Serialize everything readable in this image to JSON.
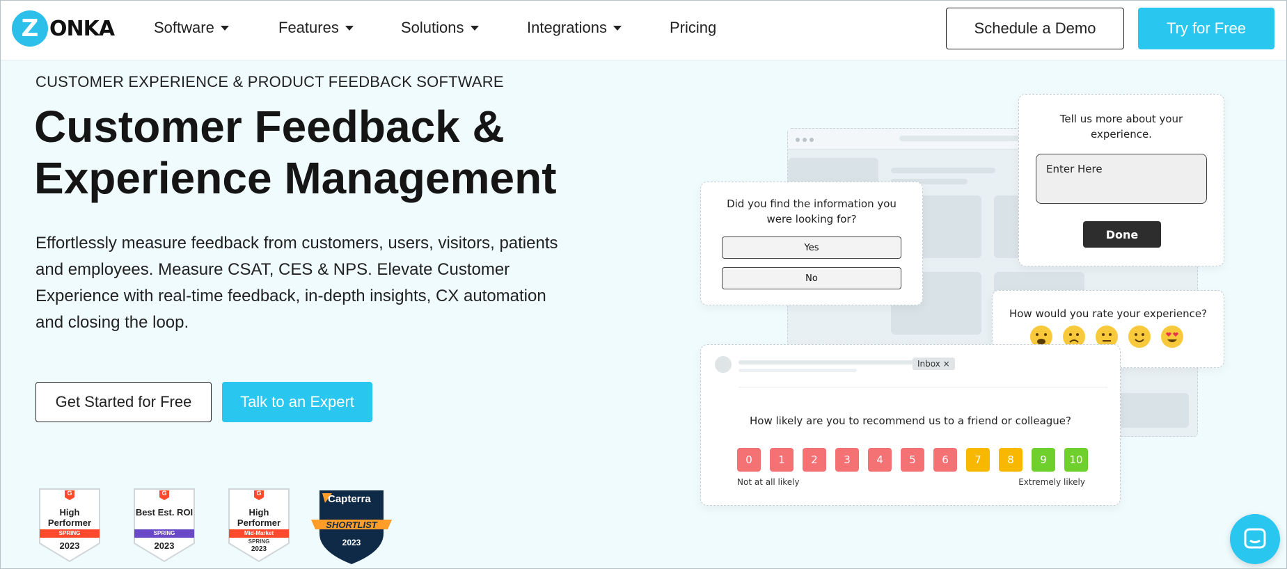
{
  "brand": {
    "logo_letter": "Z",
    "logo_text": "ONKA",
    "accent": "#29c6f0"
  },
  "nav": {
    "items": [
      {
        "label": "Software",
        "dropdown": true
      },
      {
        "label": "Features",
        "dropdown": true
      },
      {
        "label": "Solutions",
        "dropdown": true
      },
      {
        "label": "Integrations",
        "dropdown": true
      },
      {
        "label": "Pricing",
        "dropdown": false
      }
    ],
    "demo_label": "Schedule a Demo",
    "try_label": "Try for Free"
  },
  "hero": {
    "eyebrow": "CUSTOMER EXPERIENCE & PRODUCT FEEDBACK SOFTWARE",
    "title_line1": "Customer Feedback &",
    "title_line2": "Experience Management",
    "description": "Effortlessly measure feedback from customers, users, visitors, patients and employees. Measure CSAT, CES & NPS. Elevate Customer Experience with real-time feedback, in-depth insights, CX automation and closing the loop.",
    "primary_cta": "Get Started for Free",
    "secondary_cta": "Talk to an Expert"
  },
  "badges": [
    {
      "g2": "G",
      "title": "High Performer",
      "band": "SPRING",
      "year": "2023",
      "band_color": "#ff492c"
    },
    {
      "g2": "G",
      "title": "Best Est. ROI",
      "band": "SPRING",
      "year": "2023",
      "band_color": "#6a49c8"
    },
    {
      "g2": "G",
      "title": "High Performer",
      "band": "Mid-Market",
      "season": "SPRING",
      "year": "2023",
      "band_color": "#ff492c"
    }
  ],
  "capterra": {
    "name": "Capterra",
    "ribbon": "SHORTLIST",
    "year": "2023"
  },
  "illustration": {
    "info_card": {
      "question": "Did you find the information you were looking for?",
      "options": [
        "Yes",
        "No"
      ]
    },
    "more_card": {
      "question": "Tell us more about your experience.",
      "placeholder": "Enter Here",
      "done_label": "Done"
    },
    "rate_card": {
      "question": "How would you rate your experience?",
      "emojis": [
        "weary-face",
        "frowning-face",
        "neutral-face",
        "slightly-smiling-face",
        "heart-eyes-face"
      ]
    },
    "email_card": {
      "inbox_tag": "Inbox ×",
      "question": "How likely are you to recommend us to a friend or colleague?",
      "scale": [
        "0",
        "1",
        "2",
        "3",
        "4",
        "5",
        "6",
        "7",
        "8",
        "9",
        "10"
      ],
      "scale_colors": [
        "#f47174",
        "#f47174",
        "#f47174",
        "#f47174",
        "#f47174",
        "#f47174",
        "#f47174",
        "#f9b800",
        "#f9b800",
        "#6fcf2c",
        "#6fcf2c"
      ],
      "low_label": "Not at all likely",
      "high_label": "Extremely likely"
    }
  },
  "chat": {
    "icon": "chat-bubble-icon"
  }
}
